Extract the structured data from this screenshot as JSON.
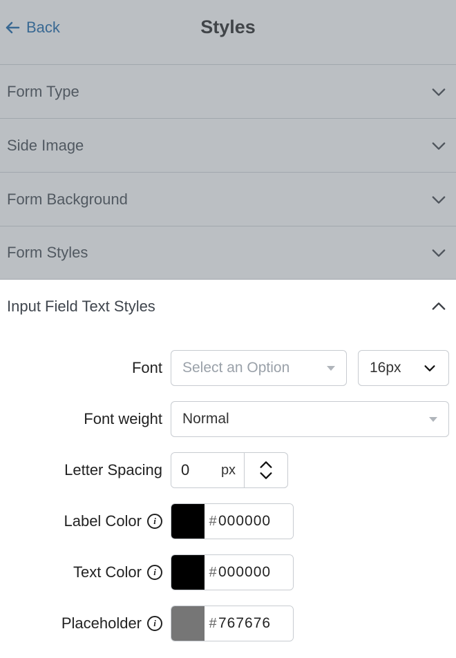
{
  "header": {
    "back_label": "Back",
    "title": "Styles"
  },
  "sections": {
    "form_type": "Form Type",
    "side_image": "Side Image",
    "form_background": "Form Background",
    "form_styles": "Form Styles",
    "input_field_text_styles": "Input Field Text Styles"
  },
  "form": {
    "font_label": "Font",
    "font_placeholder": "Select an Option",
    "font_size_value": "16px",
    "font_weight_label": "Font weight",
    "font_weight_value": "Normal",
    "letter_spacing_label": "Letter Spacing",
    "letter_spacing_value": "0",
    "letter_spacing_unit": "px",
    "label_color_label": "Label Color",
    "label_color_hex": "000000",
    "label_color_swatch": "#000000",
    "text_color_label": "Text Color",
    "text_color_hex": "000000",
    "text_color_swatch": "#000000",
    "placeholder_label": "Placeholder",
    "placeholder_hex": "767676",
    "placeholder_swatch": "#767676",
    "hash": "#"
  }
}
